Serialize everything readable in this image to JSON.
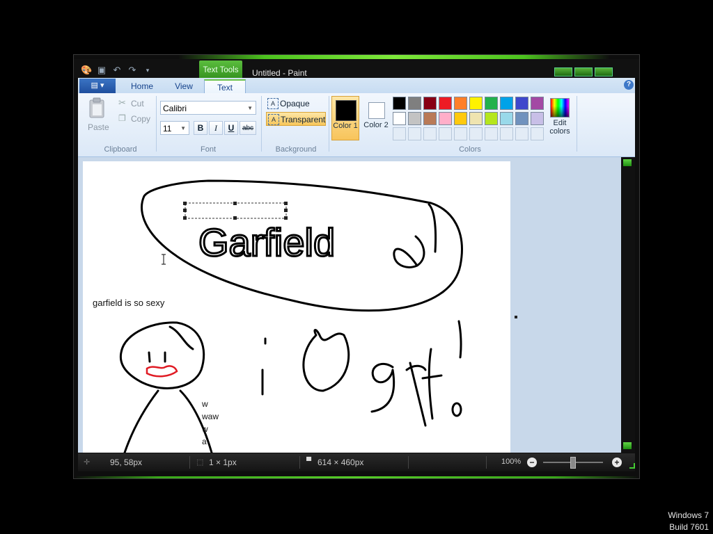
{
  "window": {
    "title": "Untitled - Paint",
    "contextual_tab": "Text Tools"
  },
  "tabs": {
    "home": "Home",
    "view": "View",
    "text": "Text"
  },
  "ribbon": {
    "clipboard": {
      "paste": "Paste",
      "cut": "Cut",
      "copy": "Copy",
      "group": "Clipboard"
    },
    "font": {
      "family": "Calibri",
      "size": "11",
      "bold": "B",
      "italic": "I",
      "underline": "U",
      "strike": "abc",
      "group": "Font"
    },
    "background": {
      "opaque": "Opaque",
      "transparent": "Transparent",
      "group": "Background",
      "selected": "Transparent"
    },
    "colors": {
      "color1_label": "Color 1",
      "color2_label": "Color 2",
      "color1_value": "#000000",
      "color2_value": "#ffffff",
      "edit_label": "Edit colors",
      "group": "Colors",
      "palette_row1": [
        "#000000",
        "#7f7f7f",
        "#880015",
        "#ed1c24",
        "#ff7f27",
        "#fff200",
        "#22b14c",
        "#00a2e8",
        "#3f48cc",
        "#a349a4"
      ],
      "palette_row2": [
        "#ffffff",
        "#c3c3c3",
        "#b97a57",
        "#ffaec9",
        "#ffc90e",
        "#efe4b0",
        "#b5e61d",
        "#99d9ea",
        "#7092be",
        "#c8bfe7"
      ]
    }
  },
  "canvas": {
    "caption_text": "garfield is so sexy",
    "drawn_word": "Garfield",
    "side_text": [
      "w",
      "waw",
      "w",
      "a"
    ]
  },
  "status": {
    "cursor_pos": "95, 58px",
    "selection_size": "1 × 1px",
    "image_size": "614 × 460px",
    "zoom": "100%"
  },
  "os": {
    "line1": "Windows 7",
    "line2": "Build 7601"
  }
}
